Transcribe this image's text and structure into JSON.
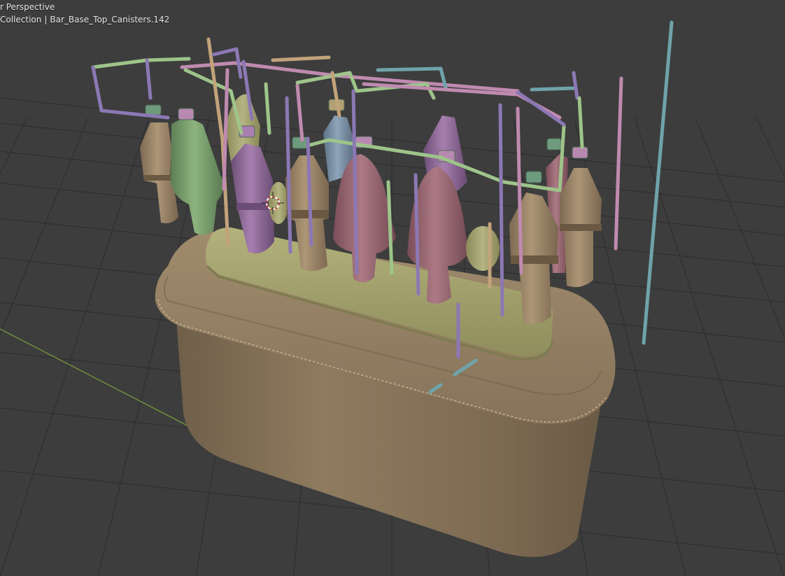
{
  "viewport": {
    "view_mode": "r Perspective",
    "collection": "Collection",
    "separator": "|",
    "active_object": "Bar_Base_Top_Canisters.142"
  },
  "colors": {
    "background": "#3d3d3d",
    "grid_line": "#2e2e2e",
    "x_axis": "#6f8f3a",
    "base_body": "#8e7a5e",
    "base_rim": "#9a8566",
    "platform": "#a3a371",
    "canister_tan": "#a08a6a",
    "canister_green": "#7fa070",
    "canister_purple": "#9a72a0",
    "canister_pink": "#a06e78",
    "canister_blue": "#7f94aa",
    "pipe_green": "#9ec48a",
    "pipe_purple": "#8c78b4",
    "pipe_pink": "#c08ab0",
    "pipe_tan": "#c2a37a",
    "pipe_teal": "#6fa3aa",
    "cursor_red": "#c84040"
  },
  "tools": {
    "cursor_icon": "3d-cursor-icon"
  }
}
